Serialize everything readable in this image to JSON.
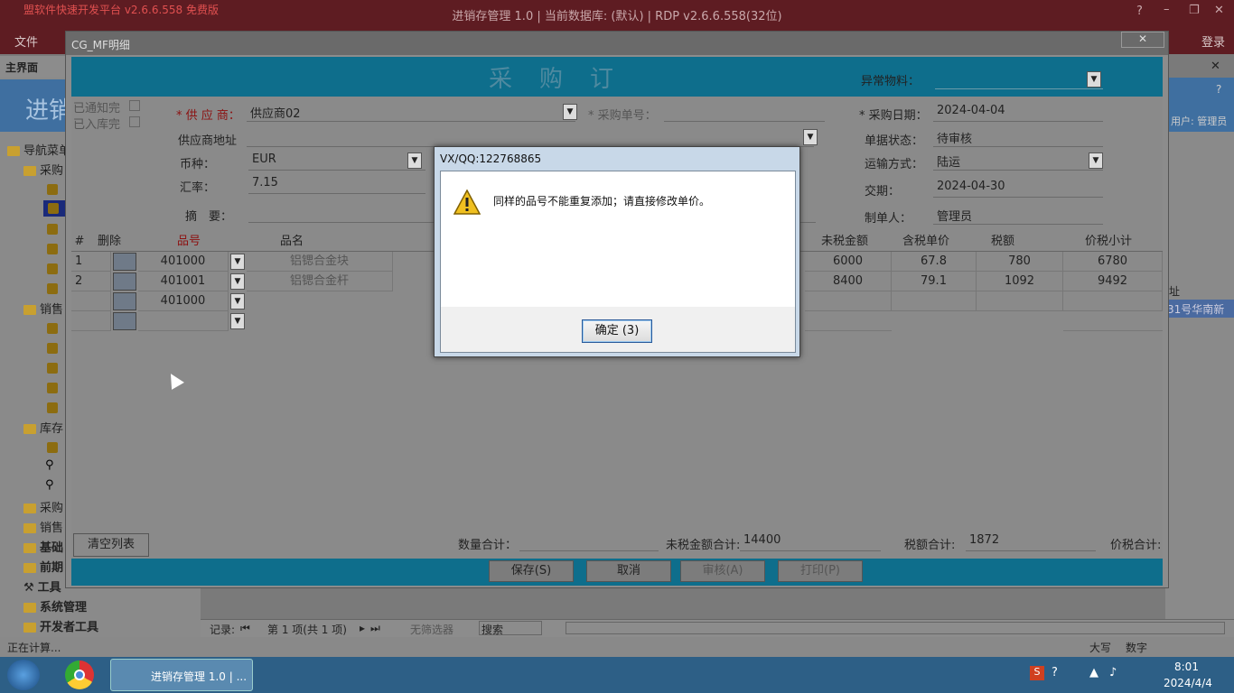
{
  "app": {
    "title": "进销存管理 1.0 | 当前数据库: (默认) | RDP v2.6.6.558(32位)",
    "edition": "盟软件快速开发平台 v2.6.6.558 免费版",
    "menu_file": "文件",
    "login": "登录"
  },
  "main_tab": "主界面",
  "banner": "进销",
  "user": "用户: 管理员",
  "nav": {
    "root": "导航菜单",
    "items": [
      "采购",
      "销售",
      "库存",
      "采购",
      "销售",
      "基础",
      "前期",
      "工具",
      "系统管理",
      "开发者工具"
    ]
  },
  "child": {
    "title": "CG_MF明细"
  },
  "form": {
    "title": "采购订单",
    "abnormal_label": "异常物料：",
    "notified_label": "已通知完",
    "stocked_label": "已入库完",
    "supplier_label": "* 供 应 商：",
    "supplier_value": "供应商02",
    "order_no_label": "* 采购单号：",
    "date_label": "* 采购日期：",
    "date_value": "2024-04-04",
    "address_label": "供应商地址",
    "status_label": "单据状态：",
    "status_value": "待审核",
    "currency_label": "币种：",
    "currency_value": "EUR",
    "transport_label": "运输方式：",
    "transport_value": "陆运",
    "rate_label": "汇率：",
    "rate_value": "7.15",
    "delivery_label": "交期：",
    "delivery_value": "2024-04-30",
    "memo_label": "摘　要：",
    "creator_label": "制单人：",
    "creator_value": "管理员"
  },
  "grid": {
    "headers": {
      "no": "#",
      "del": "删除",
      "code": "品号",
      "name": "品名",
      "amount": "未税金额",
      "tax_price": "含税单价",
      "tax": "税额",
      "total": "价税小计"
    },
    "rows": [
      {
        "no": "1",
        "code": "401000",
        "name": "铝锶合金块",
        "amount": "6000",
        "tax_price": "67.8",
        "tax": "780",
        "total": "6780"
      },
      {
        "no": "2",
        "code": "401001",
        "name": "铝锶合金杆",
        "amount": "8400",
        "tax_price": "79.1",
        "tax": "1092",
        "total": "9492"
      },
      {
        "no": "",
        "code": "401000",
        "name": "",
        "amount": "",
        "tax_price": "",
        "tax": "",
        "total": ""
      },
      {
        "no": "",
        "code": "",
        "name": "",
        "amount": "",
        "tax_price": "",
        "tax": "",
        "total": ""
      }
    ]
  },
  "totals": {
    "clear_btn": "清空列表",
    "qty_label": "数量合计：",
    "amount_label": "未税金额合计:",
    "amount_value": "14400",
    "tax_label": "税额合计:",
    "tax_value": "1872",
    "total_label": "价税合计:"
  },
  "buttons": {
    "save": "保存(S)",
    "cancel": "取消",
    "audit": "审核(A)",
    "print": "打印(P)"
  },
  "dialog": {
    "title": "VX/QQ:122768865",
    "message": "同样的品号不能重复添加；请直接修改单价。",
    "ok": "确定 (3)"
  },
  "bottom": {
    "records": "记录:",
    "page": "第 1 项(共 1 项)",
    "no_filter": "无筛选器",
    "search": "搜索"
  },
  "right_snippet": {
    "col": "址",
    "addr": "31号华南新"
  },
  "status": {
    "text": "正在计算...",
    "caps": "大写",
    "num": "数字"
  },
  "taskbar": {
    "app": "进销存管理 1.0 | ...",
    "time": "8:01",
    "date": "2024/4/4"
  }
}
